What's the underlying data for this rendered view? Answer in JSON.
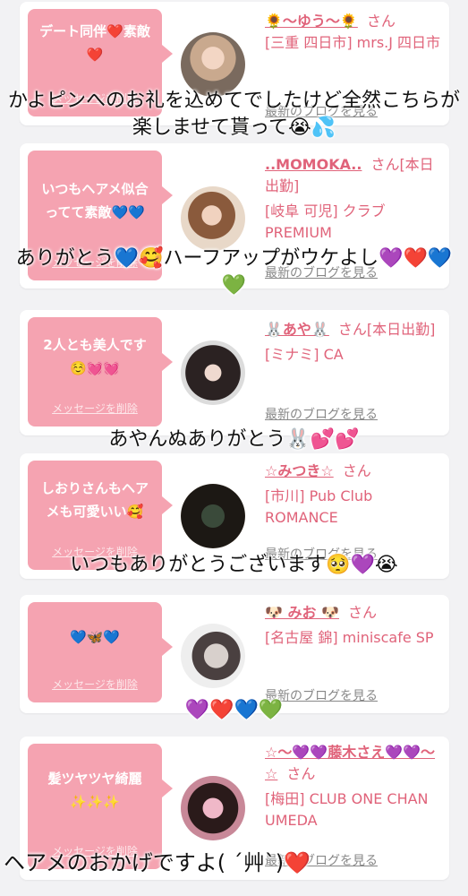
{
  "cards": [
    {
      "message": "デート同伴❤️素敵❤️",
      "delete_label": "メッセージを削除",
      "name": "🌻〜ゆう〜🌻",
      "san": "さん",
      "store": "[三重 四日市] mrs.J 四日市",
      "blog_label": "最新のブログを見る",
      "overlay": "かよピンへのお礼を込めてでしたけど全然こちらが楽しませて貰って😭💦"
    },
    {
      "message": "いつもヘアメ似合ってて素敵💙💙",
      "delete_label": "メッセージを削除",
      "name": "..MOMOKA..",
      "san": "さん[本日出勤]",
      "store": "[岐阜 可児] クラブ PREMIUM",
      "blog_label": "最新のブログを見る",
      "overlay": "ありがとう💙🥰ハーフアップがウケよし💜❤️💙💚"
    },
    {
      "message": "2人とも美人です☺️💓💓",
      "delete_label": "メッセージを削除",
      "name": "🐰あや🐰",
      "san": "さん[本日出勤]",
      "store": "[ミナミ] CA",
      "blog_label": "最新のブログを見る",
      "overlay": "あやんぬありがとう🐰💕💕"
    },
    {
      "message": "しおりさんもヘアメも可愛いい🥰",
      "delete_label": "メッセージを削除",
      "name": "☆みつき☆",
      "san": "さん",
      "store": "[市川] Pub Club ROMANCE",
      "blog_label": "最新のブログを見る",
      "overlay": "いつもありがとうございます🥺💜😭"
    },
    {
      "message": "💙🦋💙",
      "delete_label": "メッセージを削除",
      "name": "🐶 みお 🐶",
      "san": "さん",
      "store": "[名古屋 錦] miniscafe SP",
      "blog_label": "最新のブログを見る",
      "overlay": "💜❤️💙💚"
    },
    {
      "message": "髪ツヤツヤ綺麗✨✨✨",
      "delete_label": "メッセージを削除",
      "name": "☆〜💜💜藤木さえ💜💜〜☆",
      "san": "さん",
      "store": "[梅田] CLUB ONE CHAN UMEDA",
      "blog_label": "最新のブログを見る",
      "overlay": "ヘアメのおかげですよ( ´艸`)❤️"
    }
  ]
}
